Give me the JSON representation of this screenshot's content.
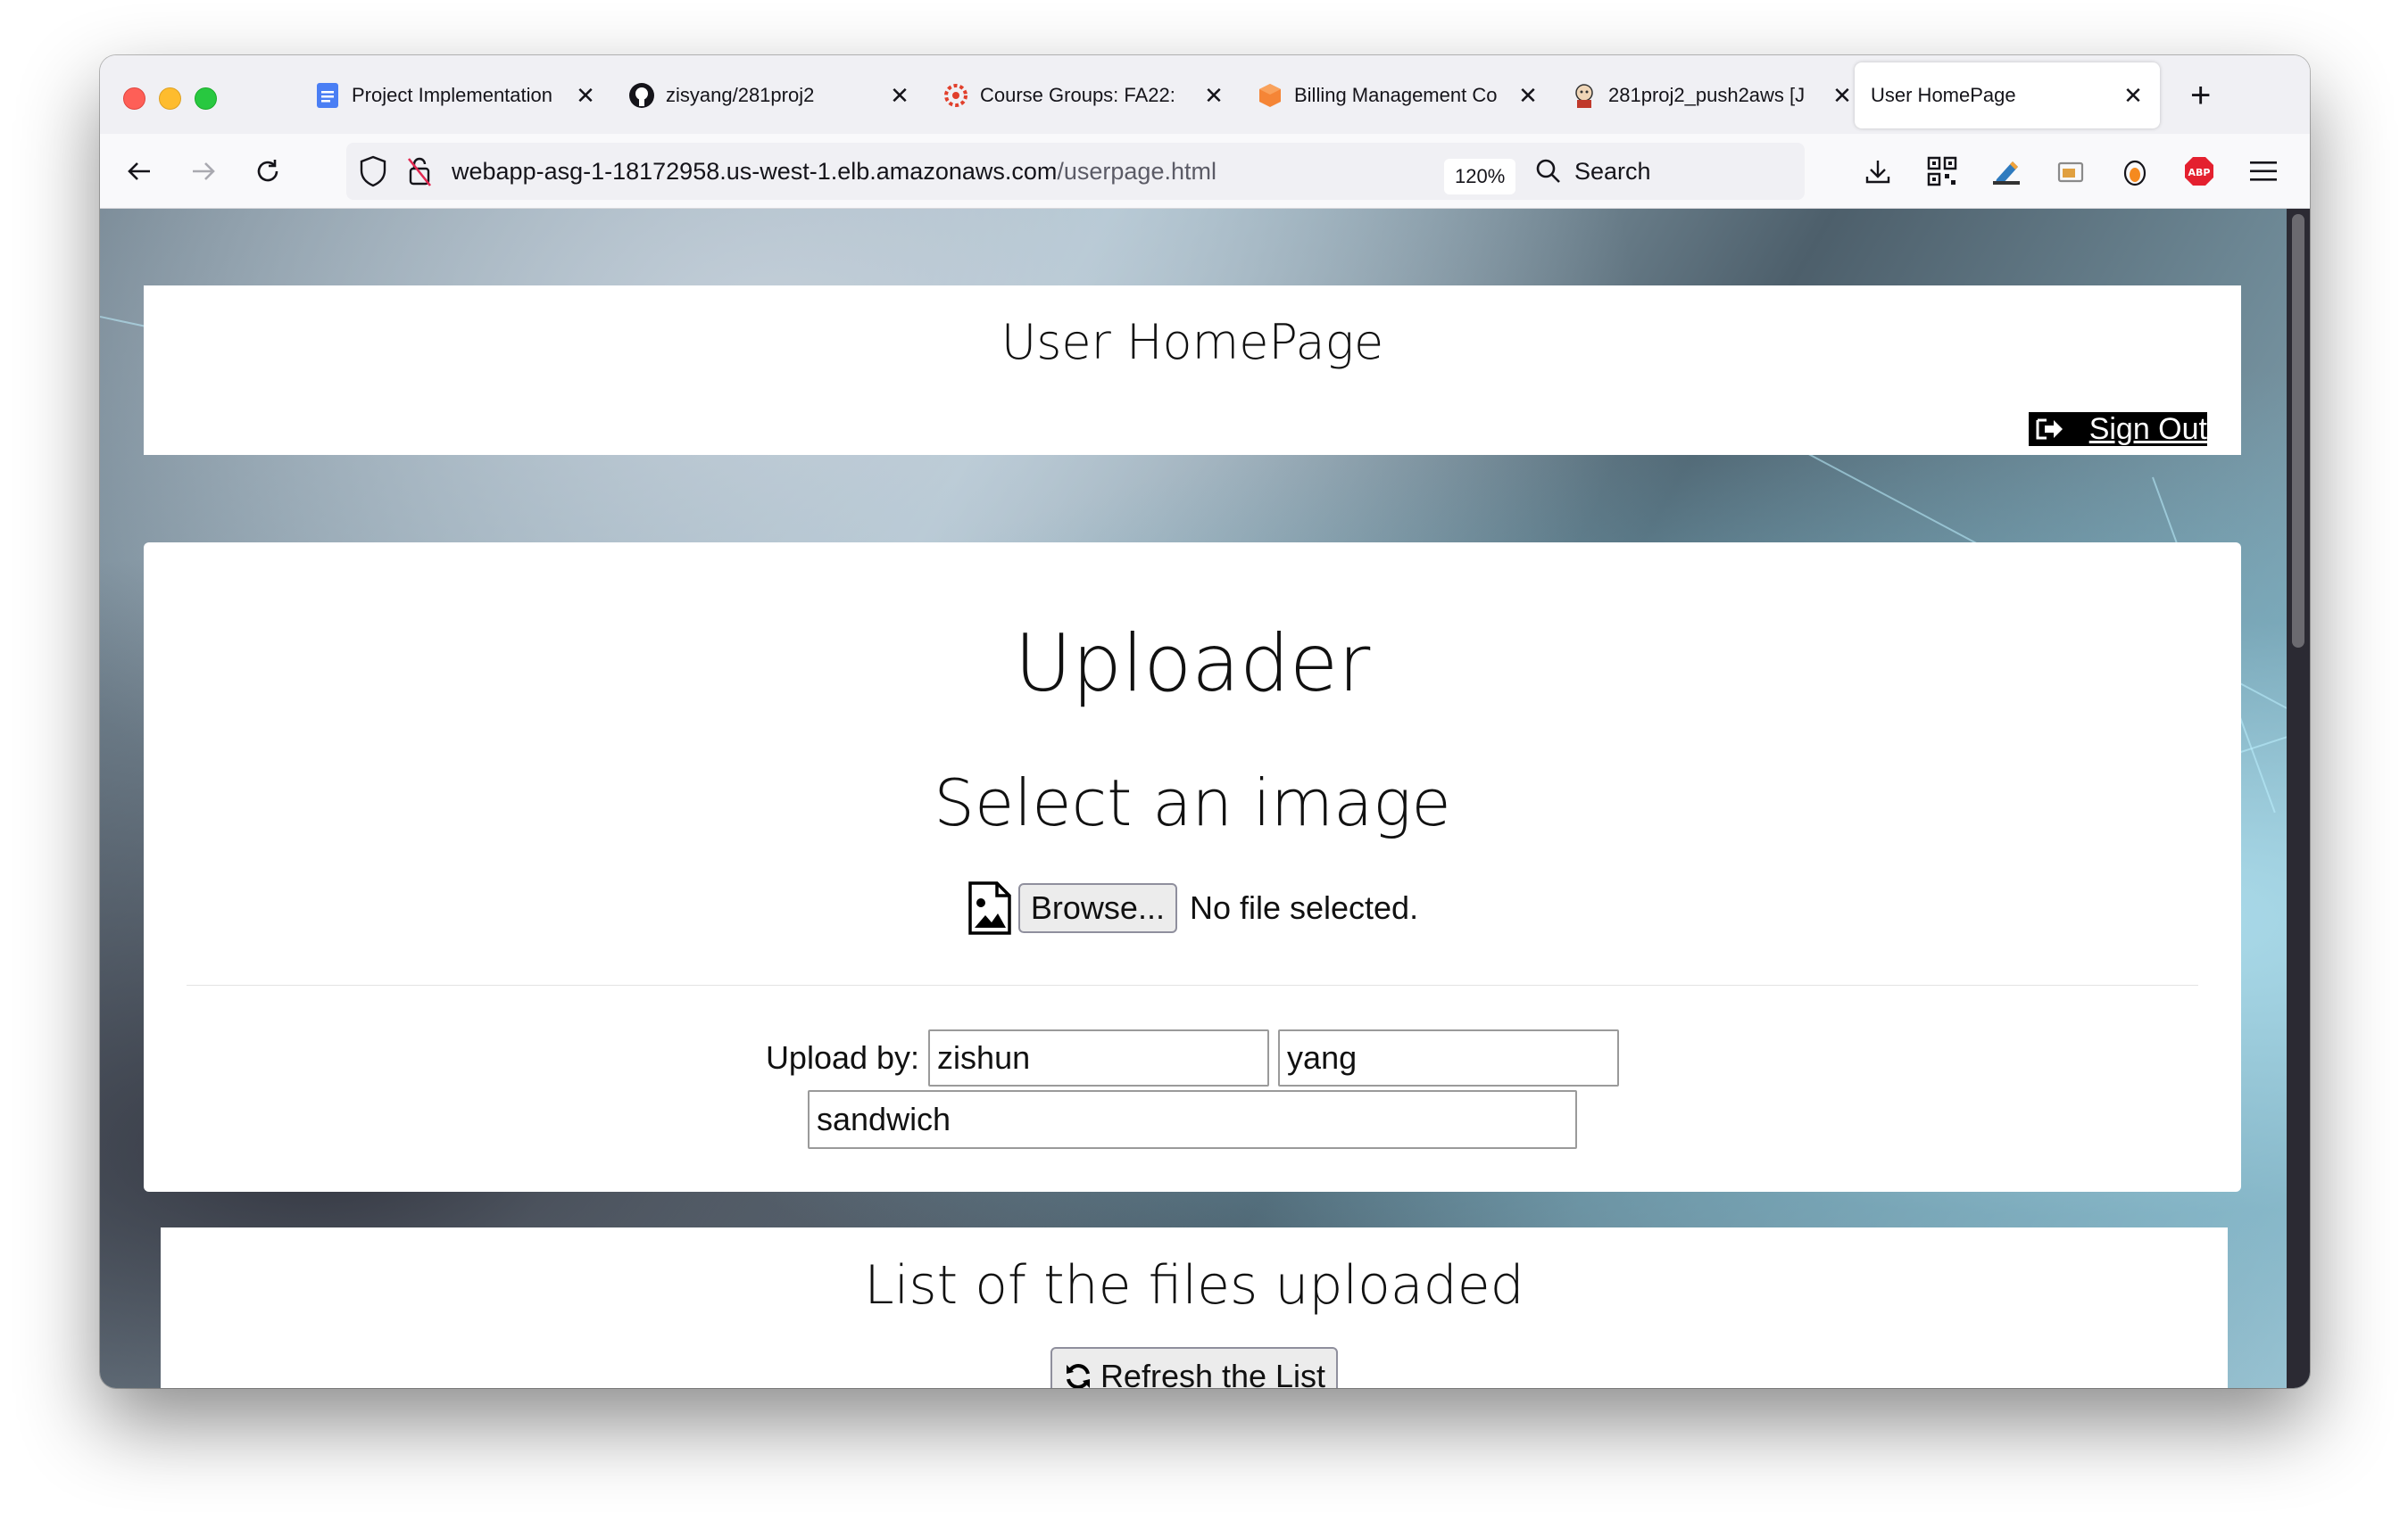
{
  "browser": {
    "tabs": [
      {
        "title": "Project Implementation",
        "icon": "google-docs-icon"
      },
      {
        "title": "zisyang/281proj2",
        "icon": "github-icon"
      },
      {
        "title": "Course Groups: FA22:",
        "icon": "canvas-icon"
      },
      {
        "title": "Billing Management Co",
        "icon": "aws-icon"
      },
      {
        "title": "281proj2_push2aws [J",
        "icon": "jenkins-icon"
      },
      {
        "title": "User HomePage",
        "icon": ""
      }
    ],
    "url_host": "webapp-asg-1-18172958.us-west-1.elb.amazonaws.com",
    "url_path": "/userpage.html",
    "zoom": "120%",
    "search_placeholder": "Search"
  },
  "page": {
    "header_title": "User HomePage",
    "sign_out_label": "Sign Out",
    "uploader_title": "Uploader",
    "select_title": "Select an image",
    "browse_label": "Browse...",
    "file_status": "No file selected.",
    "upload_by_label": "Upload by:",
    "first_name_value": "zishun",
    "last_name_value": "yang",
    "description_value": "sandwich",
    "list_title": "List of the files uploaded",
    "refresh_label": "Refresh the List"
  },
  "colors": {
    "tab_active_bg": "#ffffff",
    "chrome_bg": "#f0f0f4",
    "signout_bg": "#000000"
  }
}
